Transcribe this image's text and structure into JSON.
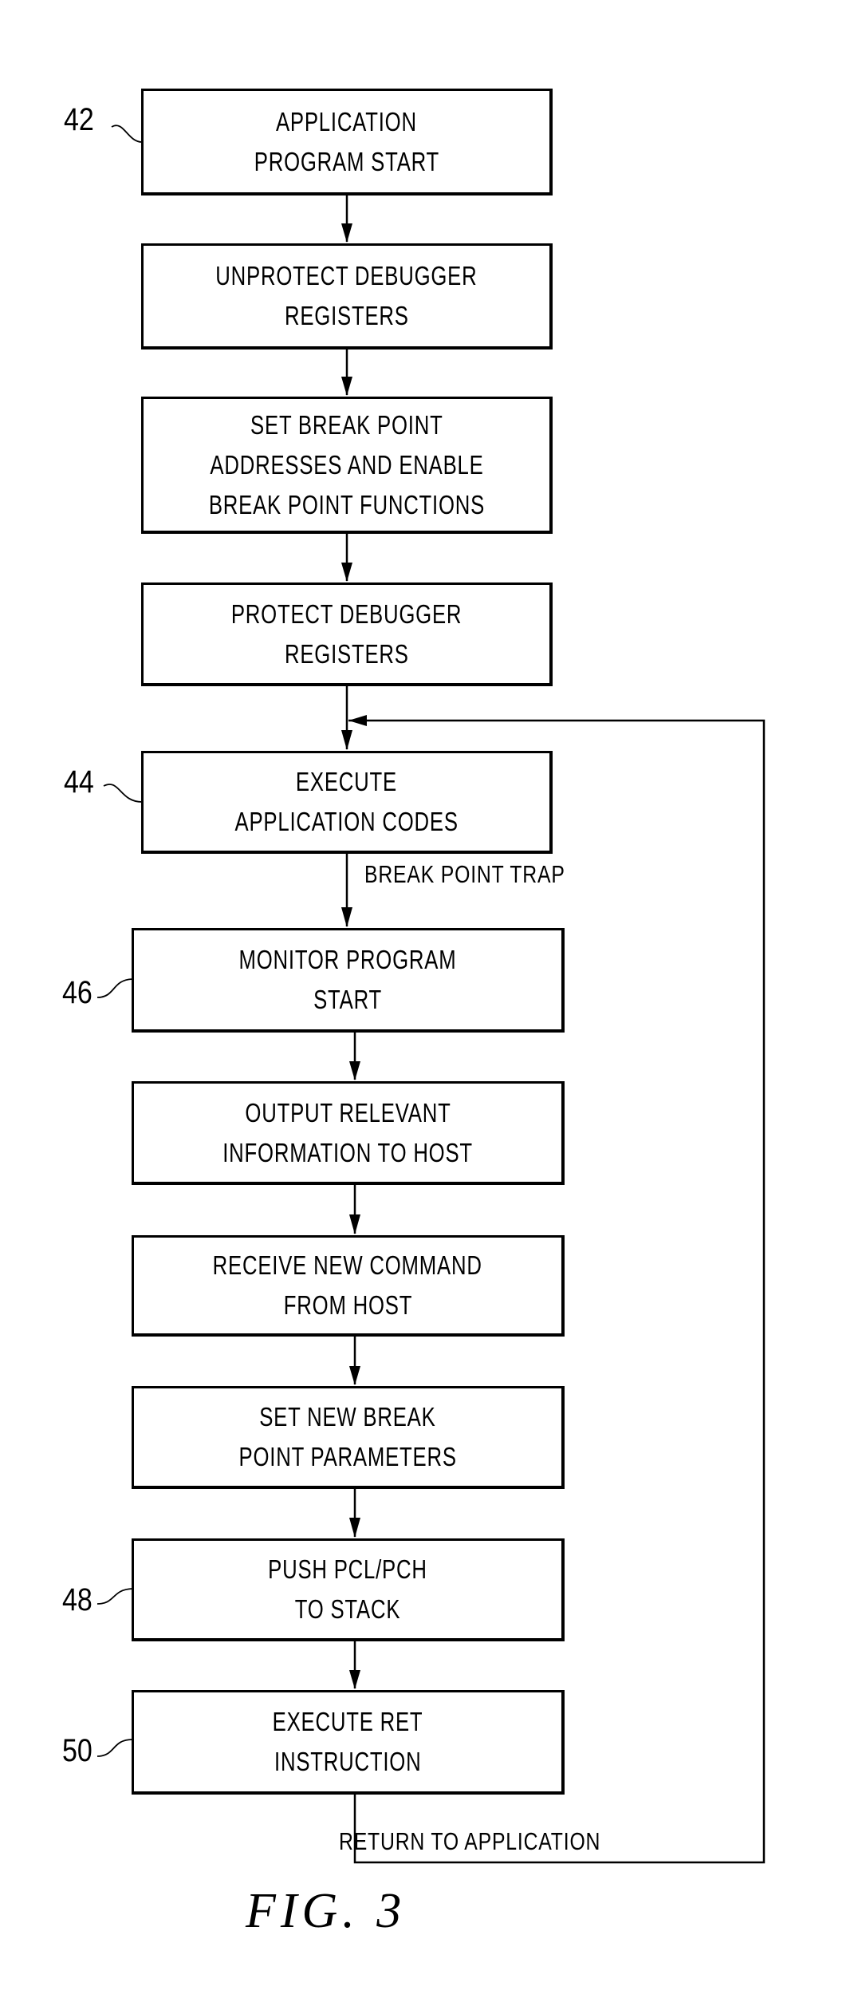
{
  "figure_label": "FIG. 3",
  "steps": [
    {
      "id": "s1",
      "ref": "42",
      "lines": [
        "APPLICATION",
        "PROGRAM START"
      ]
    },
    {
      "id": "s2",
      "ref": "",
      "lines": [
        "UNPROTECT DEBUGGER",
        "REGISTERS"
      ]
    },
    {
      "id": "s3",
      "ref": "",
      "lines": [
        "SET BREAK POINT",
        "ADDRESSES AND ENABLE",
        "BREAK POINT FUNCTIONS"
      ]
    },
    {
      "id": "s4",
      "ref": "",
      "lines": [
        "PROTECT DEBUGGER",
        "REGISTERS"
      ]
    },
    {
      "id": "s5",
      "ref": "44",
      "lines": [
        "EXECUTE",
        "APPLICATION CODES"
      ]
    },
    {
      "id": "s6",
      "ref": "46",
      "lines": [
        "MONITOR PROGRAM",
        "START"
      ]
    },
    {
      "id": "s7",
      "ref": "",
      "lines": [
        "OUTPUT RELEVANT",
        "INFORMATION TO HOST"
      ]
    },
    {
      "id": "s8",
      "ref": "",
      "lines": [
        "RECEIVE NEW COMMAND",
        "FROM HOST"
      ]
    },
    {
      "id": "s9",
      "ref": "",
      "lines": [
        "SET NEW BREAK",
        "POINT PARAMETERS"
      ]
    },
    {
      "id": "s10",
      "ref": "48",
      "lines": [
        "PUSH PCL/PCH",
        "TO STACK"
      ]
    },
    {
      "id": "s11",
      "ref": "50",
      "lines": [
        "EXECUTE RET",
        "INSTRUCTION"
      ]
    }
  ],
  "edge_labels": {
    "break_point_trap": "BREAK POINT TRAP",
    "return_to_application": "RETURN TO APPLICATION"
  }
}
